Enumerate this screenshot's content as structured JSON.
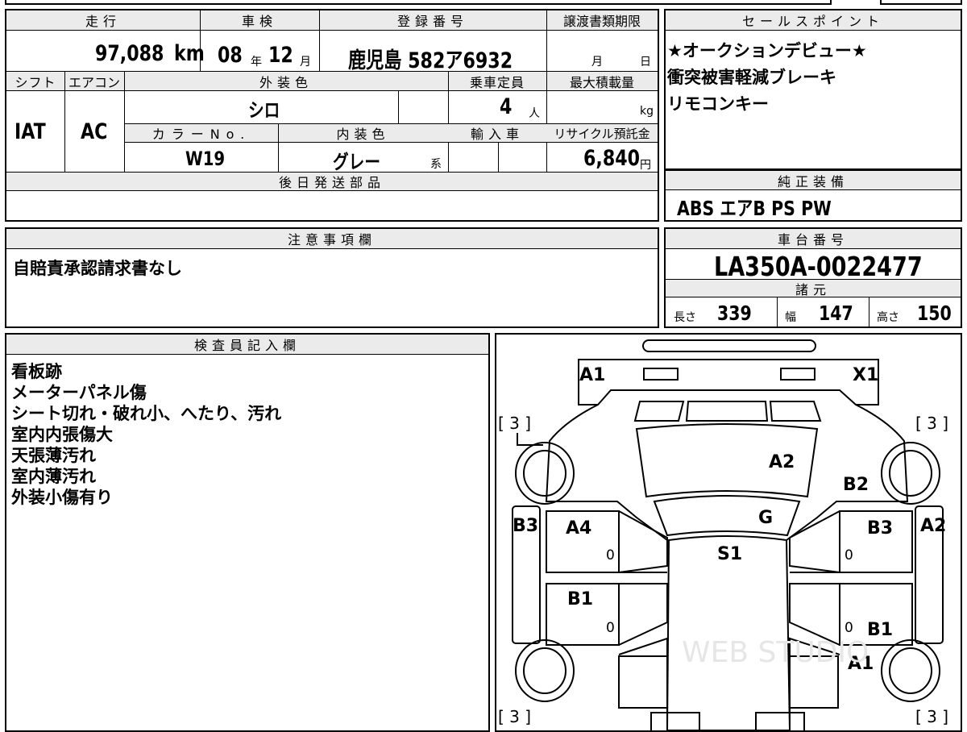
{
  "top_info": {
    "mileage_label": "走行",
    "mileage_value": "97,088",
    "mileage_unit": "km",
    "inspection_label": "車検",
    "inspection_year": "08",
    "inspection_year_unit": "年",
    "inspection_month": "12",
    "inspection_month_unit": "月",
    "registration_label": "登録番号",
    "registration_value": "鹿児島 582ア6932",
    "transfer_label": "譲渡書類期限",
    "transfer_month_unit": "月",
    "transfer_day_unit": "日",
    "shift_label": "シフト",
    "shift_value": "IAT",
    "aircon_label": "エアコン",
    "aircon_value": "AC",
    "exterior_color_label": "外装色",
    "exterior_color_value": "シロ",
    "capacity_label": "乗車定員",
    "capacity_value": "4",
    "capacity_unit": "人",
    "max_load_label": "最大積載量",
    "max_load_unit": "kg",
    "color_no_label": "カラーNo.",
    "color_no_value": "W19",
    "interior_color_label": "内装色",
    "interior_color_value": "グレー",
    "interior_color_suffix": "系",
    "import_label": "輸入車",
    "recycle_label": "リサイクル預託金",
    "recycle_value": "6,840",
    "recycle_unit": "円",
    "later_parts_label": "後日発送部品"
  },
  "sales_points": {
    "header": "セールスポイント",
    "lines": [
      "★オークションデビュー★",
      "衝突被害軽減ブレーキ",
      "リモコンキー"
    ]
  },
  "equipment": {
    "header": "純正装備",
    "value": "ABS エアB PS PW"
  },
  "notes": {
    "header": "注意事項欄",
    "value": "自賠責承認請求書なし"
  },
  "chassis": {
    "header": "車台番号",
    "value": "LA350A-0022477",
    "spec_header": "諸元",
    "length_label": "長さ",
    "length_value": "339",
    "width_label": "幅",
    "width_value": "147",
    "height_label": "高さ",
    "height_value": "150"
  },
  "inspector": {
    "header": "検査員記入欄",
    "lines": [
      "看板跡",
      "メーターパネル傷",
      "シート切れ・破れ小、へたり、汚れ",
      "室内内張傷大",
      "天張薄汚れ",
      "室内薄汚れ",
      "外装小傷有り"
    ]
  },
  "diagram": {
    "labels": {
      "front_left": "A1",
      "front_right": "X1",
      "hood": "A2",
      "glass": "G",
      "roof": "S1",
      "front_door_left": "A4",
      "rear_door_left": "B1",
      "left_sill": "B3",
      "right_fender": "B2",
      "right_front_door": "B3",
      "right_sill": "A2",
      "right_rear_door": "B1",
      "right_rear_quarter": "A1"
    },
    "tire_tl": "[ 3 ]",
    "tire_tr": "[ 3 ]",
    "tire_bl": "[ 3 ]",
    "tire_br": "[ 3 ]",
    "zero": "0",
    "watermark": "WEB STUDIO"
  }
}
